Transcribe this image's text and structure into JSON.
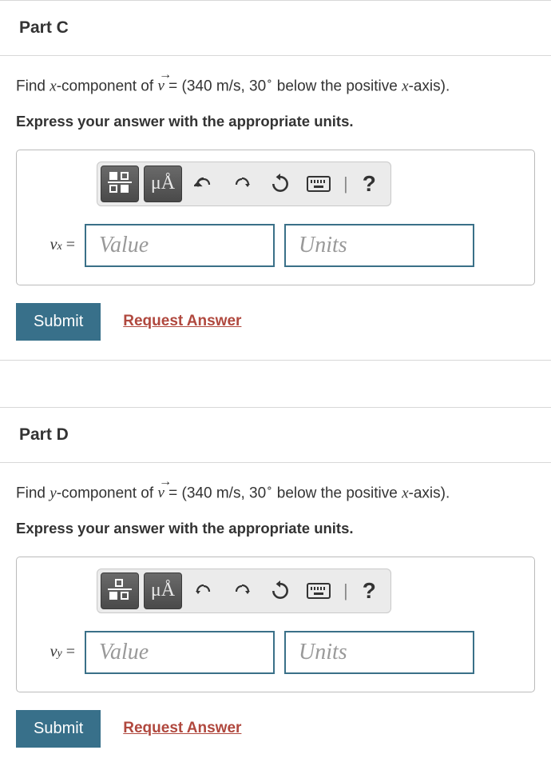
{
  "partC": {
    "title": "Part C",
    "prompt_pre": "Find ",
    "prompt_var": "x",
    "prompt_mid": "-component of ",
    "prompt_vec": "v",
    "prompt_eq": " = (340 m/s, 30",
    "prompt_deg": "∘",
    "prompt_post": "  below the positive ",
    "prompt_axis": "x",
    "prompt_end": "-axis).",
    "instruction": "Express your answer with the appropriate units.",
    "units_label": "μÅ",
    "var_base": "v",
    "var_sub": "x",
    "var_eq": " =",
    "value_ph": "Value",
    "units_ph": "Units",
    "submit": "Submit",
    "request": "Request Answer",
    "help": "?",
    "sep": "|"
  },
  "partD": {
    "title": "Part D",
    "prompt_pre": "Find ",
    "prompt_var": "y",
    "prompt_mid": "-component of ",
    "prompt_vec": "v",
    "prompt_eq": " = (340 m/s, 30",
    "prompt_deg": "∘",
    "prompt_post": "  below the positive ",
    "prompt_axis": "x",
    "prompt_end": "-axis).",
    "instruction": "Express your answer with the appropriate units.",
    "units_label": "μÅ",
    "var_base": "v",
    "var_sub": "y",
    "var_eq": " =",
    "value_ph": "Value",
    "units_ph": "Units",
    "submit": "Submit",
    "request": "Request Answer",
    "help": "?",
    "sep": "|"
  }
}
